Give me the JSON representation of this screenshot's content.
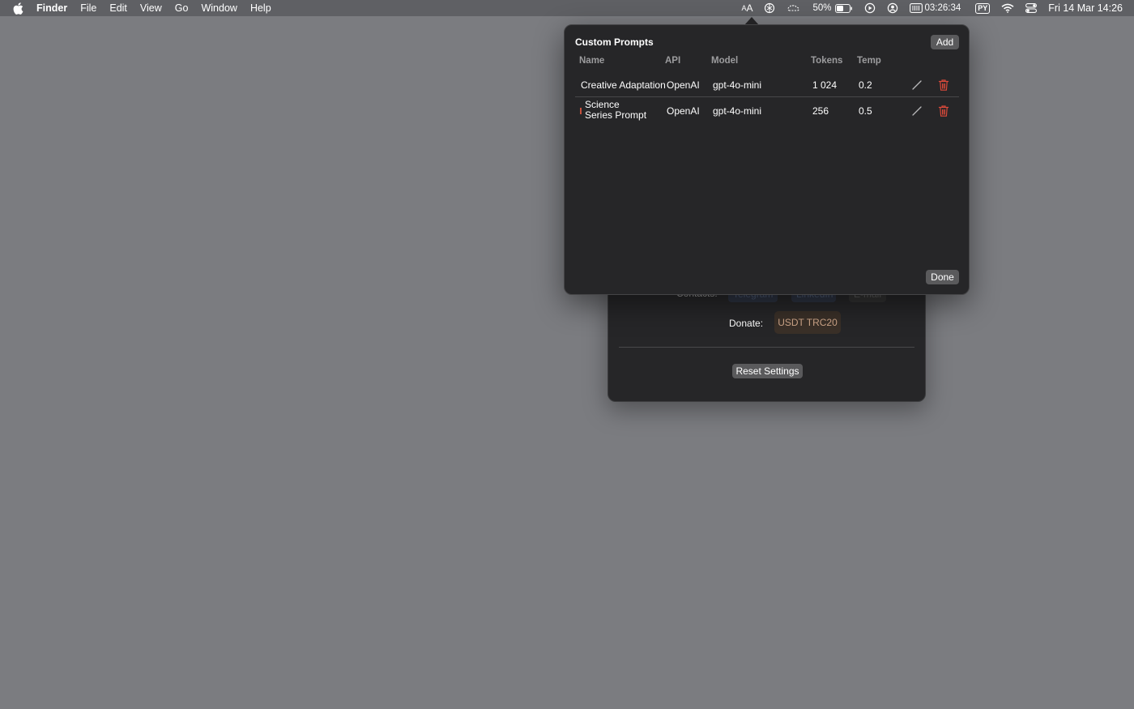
{
  "menubar": {
    "app_name": "Finder",
    "menus": [
      "File",
      "Edit",
      "View",
      "Go",
      "Window",
      "Help"
    ],
    "status": {
      "text_size_icon": "AA",
      "battery_percent": "50%",
      "timer": "03:26:34",
      "keyboard_layout": "PY",
      "datetime": "Fri 14 Mar  14:26"
    }
  },
  "settings": {
    "contacts_label": "Contacts:",
    "contacts": [
      "Telegram",
      "LinkedIn",
      "E-mail"
    ],
    "donate_label": "Donate:",
    "donate_button": "USDT TRC20",
    "reset_button": "Reset Settings"
  },
  "popover": {
    "title": "Custom Prompts",
    "add_button": "Add",
    "done_button": "Done",
    "columns": {
      "name": "Name",
      "api": "API",
      "model": "Model",
      "tokens": "Tokens",
      "temp": "Temp"
    },
    "rows": [
      {
        "name": "Creative Adaptation",
        "api": "OpenAI",
        "model": "gpt-4o-mini",
        "tokens": "1 024",
        "temp": "0.2"
      },
      {
        "name_line1": "Science",
        "name_line2": "Series Prompt",
        "api": "OpenAI",
        "model": "gpt-4o-mini",
        "tokens": "256",
        "temp": "0.5"
      }
    ]
  },
  "colors": {
    "desktop": "#7b7c80",
    "panel": "#262628",
    "delete_red": "#d9493a"
  }
}
